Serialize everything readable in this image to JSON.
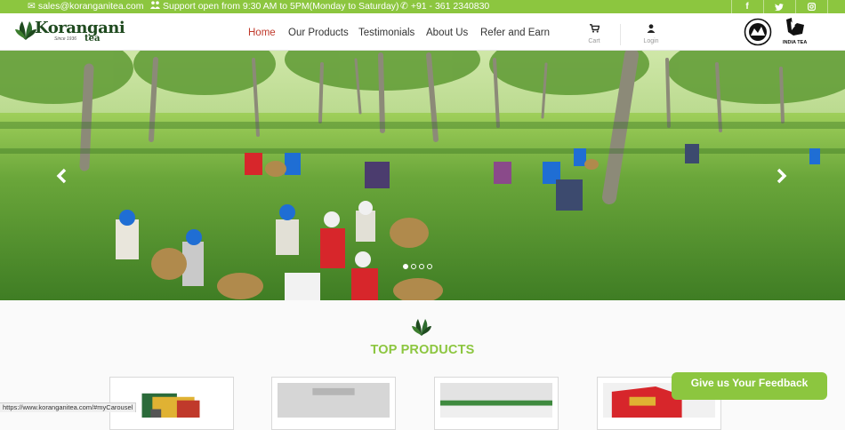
{
  "topbar": {
    "email": "sales@koranganitea.com",
    "support": "Support open from 9:30 AM to 5PM(Monday to Saturday)",
    "phone": "+91 - 361 2340830",
    "social": [
      {
        "name": "facebook-icon",
        "glyph": "f"
      },
      {
        "name": "twitter-icon",
        "glyph": "t"
      },
      {
        "name": "instagram-icon",
        "glyph": "◎"
      }
    ]
  },
  "brand": {
    "name": "Korangani",
    "since": "Since 1936",
    "sub": "tea"
  },
  "nav": {
    "items": [
      "Home",
      "Our Products",
      "Testimonials",
      "About Us",
      "Refer and Earn"
    ],
    "active": "Home",
    "cart_label": "Cart",
    "login_label": "Login",
    "badge_text": "INDIA TEA"
  },
  "colors": {
    "brand_green": "#8cc63f",
    "active_link": "#c0392b"
  },
  "carousel": {
    "prev_glyph": "‹",
    "next_glyph": "›",
    "slides": 4,
    "active_slide": 1
  },
  "products": {
    "title": "TOP PRODUCTS"
  },
  "feedback": {
    "label": "Give us Your Feedback"
  },
  "status": {
    "url": "https://www.koranganitea.com/#myCarousel"
  }
}
